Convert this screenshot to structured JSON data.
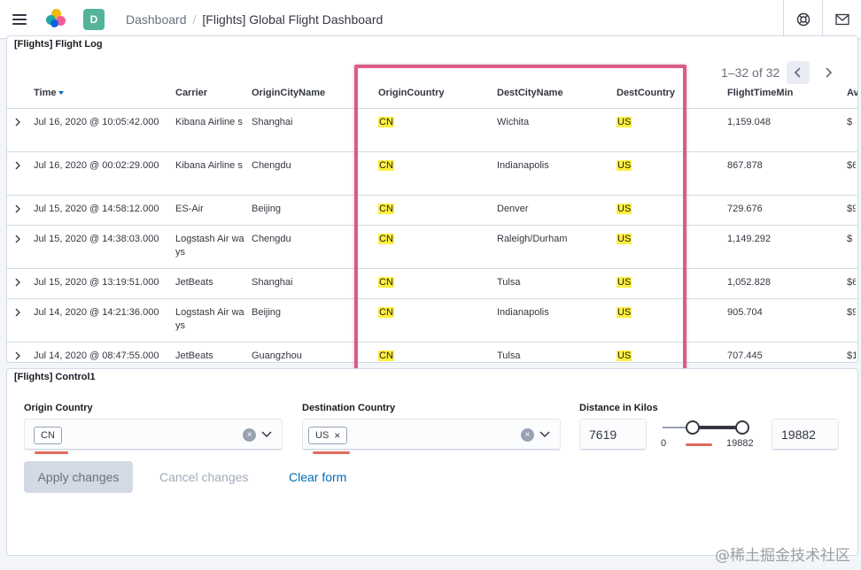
{
  "header": {
    "menu_icon": "hamburger-menu-icon",
    "logo_icon": "elastic-logo-icon",
    "space_initial": "D",
    "breadcrumbs": [
      "Dashboard",
      "[Flights] Global Flight Dashboard"
    ],
    "help_icon": "lifebuoy-help-icon",
    "news_icon": "mail-news-icon"
  },
  "flight_log": {
    "title": "[Flights] Flight Log",
    "pager": "1–32 of 32",
    "columns": [
      "Time",
      "Carrier",
      "OriginCityName",
      "OriginCountry",
      "DestCityName",
      "DestCountry",
      "FlightTimeMin",
      "Av"
    ],
    "rows": [
      {
        "time": "Jul 16, 2020 @ 10:05:42.000",
        "carrier": "Kibana Airline s",
        "origin_city": "Shanghai",
        "origin_country": "CN",
        "dest_city": "Wichita",
        "dest_country": "US",
        "flight_time": "1,159.048",
        "avg": "$"
      },
      {
        "time": "Jul 16, 2020 @ 00:02:29.000",
        "carrier": "Kibana Airline s",
        "origin_city": "Chengdu",
        "origin_country": "CN",
        "dest_city": "Indianapolis",
        "dest_country": "US",
        "flight_time": "867.878",
        "avg": "$6"
      },
      {
        "time": "Jul 15, 2020 @ 14:58:12.000",
        "carrier": "ES-Air",
        "origin_city": "Beijing",
        "origin_country": "CN",
        "dest_city": "Denver",
        "dest_country": "US",
        "flight_time": "729.676",
        "avg": "$9"
      },
      {
        "time": "Jul 15, 2020 @ 14:38:03.000",
        "carrier": "Logstash Air ways",
        "origin_city": "Chengdu",
        "origin_country": "CN",
        "dest_city": "Raleigh/Durham",
        "dest_country": "US",
        "flight_time": "1,149.292",
        "avg": "$"
      },
      {
        "time": "Jul 15, 2020 @ 13:19:51.000",
        "carrier": "JetBeats",
        "origin_city": "Shanghai",
        "origin_country": "CN",
        "dest_city": "Tulsa",
        "dest_country": "US",
        "flight_time": "1,052.828",
        "avg": "$6"
      },
      {
        "time": "Jul 14, 2020 @ 14:21:36.000",
        "carrier": "Logstash Air ways",
        "origin_city": "Beijing",
        "origin_country": "CN",
        "dest_city": "Indianapolis",
        "dest_country": "US",
        "flight_time": "905.704",
        "avg": "$9"
      },
      {
        "time": "Jul 14, 2020 @ 08:47:55.000",
        "carrier": "JetBeats",
        "origin_city": "Guangzhou",
        "origin_country": "CN",
        "dest_city": "Tulsa",
        "dest_country": "US",
        "flight_time": "707.445",
        "avg": "$1"
      }
    ]
  },
  "controls": {
    "title": "[Flights] Control1",
    "origin": {
      "label": "Origin Country",
      "selected": "CN"
    },
    "destination": {
      "label": "Destination Country",
      "selected": "US"
    },
    "distance": {
      "label": "Distance in Kilos",
      "min_value": "7619",
      "max_value": "19882",
      "range_min": "0",
      "range_max": "19882",
      "lower_fraction": 0.38,
      "upper_fraction": 1.0
    },
    "apply_label": "Apply changes",
    "cancel_label": "Cancel changes",
    "clear_label": "Clear form"
  },
  "watermark": "@稀土掘金技术社区",
  "colors": {
    "highlight": "#ffef3f",
    "annotation": "#dc5c84",
    "link": "#006bb8"
  }
}
